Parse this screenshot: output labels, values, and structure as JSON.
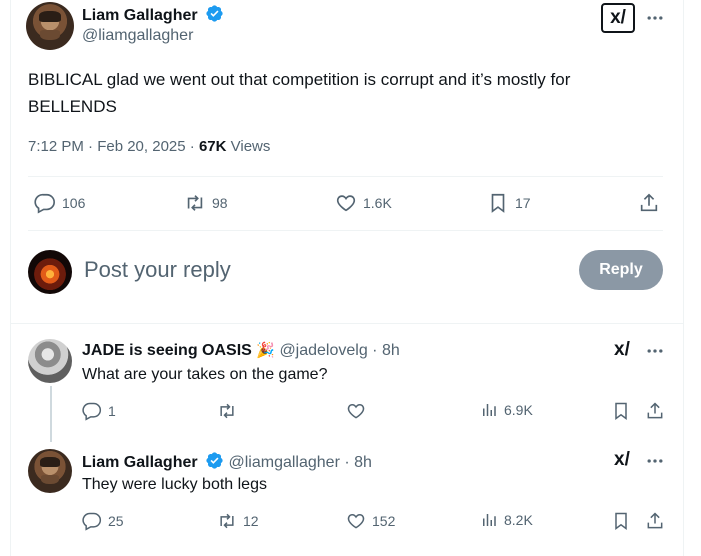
{
  "main_tweet": {
    "author_name": "Liam Gallagher",
    "author_handle": "@liamgallagher",
    "text_line1": "BIBLICAL glad we went out that competition is corrupt and it’s mostly for",
    "text_line2": "BELLENDS",
    "timestamp": "7:12 PM · Feb 20, 2025 · ",
    "views_count": "67K",
    "views_label": " Views",
    "grok_label": "x/",
    "stats": {
      "replies": "106",
      "reposts": "98",
      "likes": "1.6K",
      "bookmarks": "17"
    }
  },
  "composer": {
    "placeholder": "Post your reply",
    "reply_button": "Reply"
  },
  "replies": [
    {
      "author_name": "JADE is seeing OASIS",
      "emoji": "🎉",
      "author_handle": "@jadelovelg",
      "time": " · 8h",
      "text": "What are your takes on the game?",
      "stats": {
        "replies": "1",
        "reposts": "",
        "likes": "",
        "views": "6.9K"
      }
    },
    {
      "author_name": "Liam Gallagher",
      "author_handle": "@liamgallagher",
      "time": " · 8h",
      "text": "They were lucky both legs",
      "stats": {
        "replies": "25",
        "reposts": "12",
        "likes": "152",
        "views": "8.2K"
      }
    }
  ],
  "colors": {
    "verified": "#1d9bf0",
    "muted": "#536471",
    "reply_button_bg": "#8b98a5"
  }
}
